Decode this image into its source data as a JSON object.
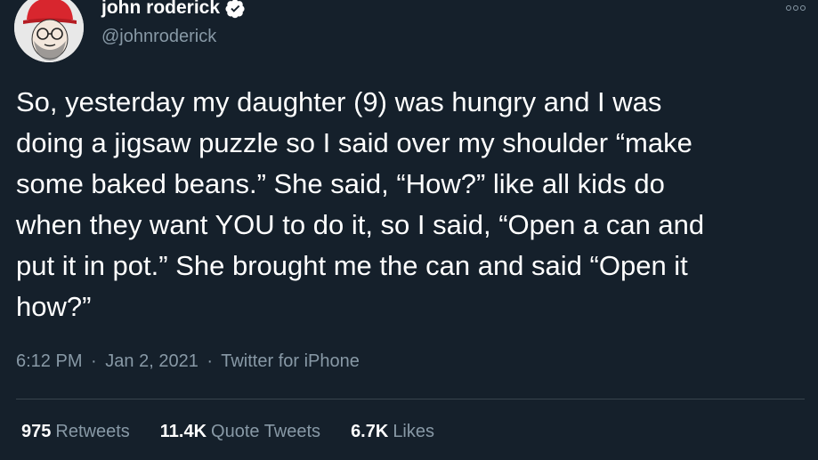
{
  "author": {
    "name": "john roderick",
    "handle": "@johnroderick",
    "verified_icon": "verified-badge-icon",
    "avatar_icon": "caricature-avatar"
  },
  "tweet": {
    "lines": [
      "So, yesterday my daughter (9) was hungry and I was",
      "doing a jigsaw puzzle so I said over my shoulder “make",
      "some baked beans.” She said, “How?” like all kids do",
      "when they want YOU to do it, so I said, “Open a can and",
      "put it in pot.” She brought me the can and said “Open it",
      "how?”"
    ],
    "time": "6:12 PM",
    "date": "Jan 2, 2021",
    "source": "Twitter for iPhone",
    "separator": "·"
  },
  "stats": {
    "retweets": {
      "count": "975",
      "label": "Retweets"
    },
    "quotes": {
      "count": "11.4K",
      "label": "Quote Tweets"
    },
    "likes": {
      "count": "6.7K",
      "label": "Likes"
    }
  },
  "colors": {
    "background": "#15202b",
    "text": "#ffffff",
    "secondary": "#8899a6",
    "divider": "#38444d",
    "verified": "#ffffff"
  }
}
